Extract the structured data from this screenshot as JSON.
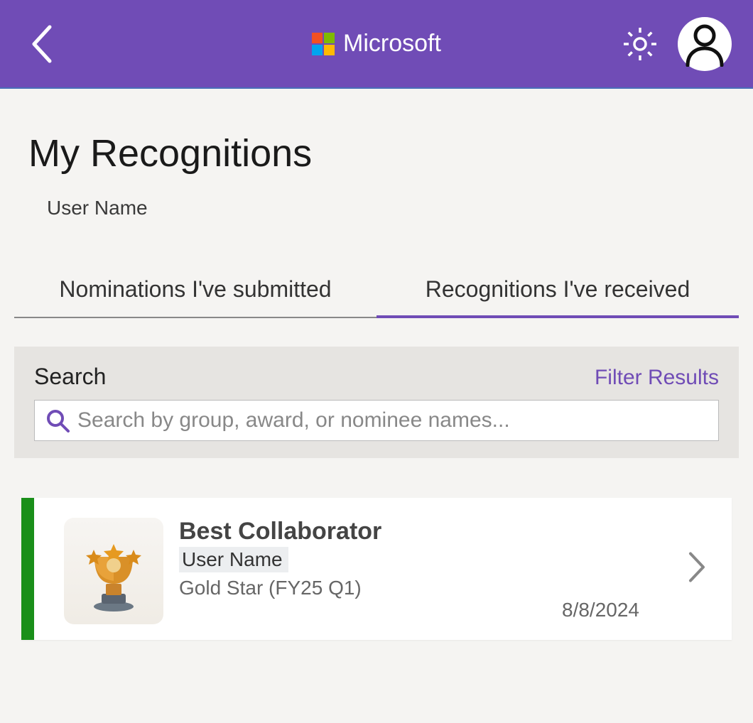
{
  "header": {
    "brand": "Microsoft"
  },
  "page": {
    "title": "My Recognitions",
    "username": "User Name"
  },
  "tabs": {
    "submitted": "Nominations I've submitted",
    "received": "Recognitions I've received",
    "active": "received"
  },
  "search": {
    "label": "Search",
    "filter": "Filter Results",
    "placeholder": "Search by group, award, or nominee names..."
  },
  "results": [
    {
      "title": "Best Collaborator",
      "user": "User Name",
      "group": "Gold Star (FY25 Q1)",
      "date": "8/8/2024",
      "stripe_color": "#1a8f1a"
    }
  ]
}
